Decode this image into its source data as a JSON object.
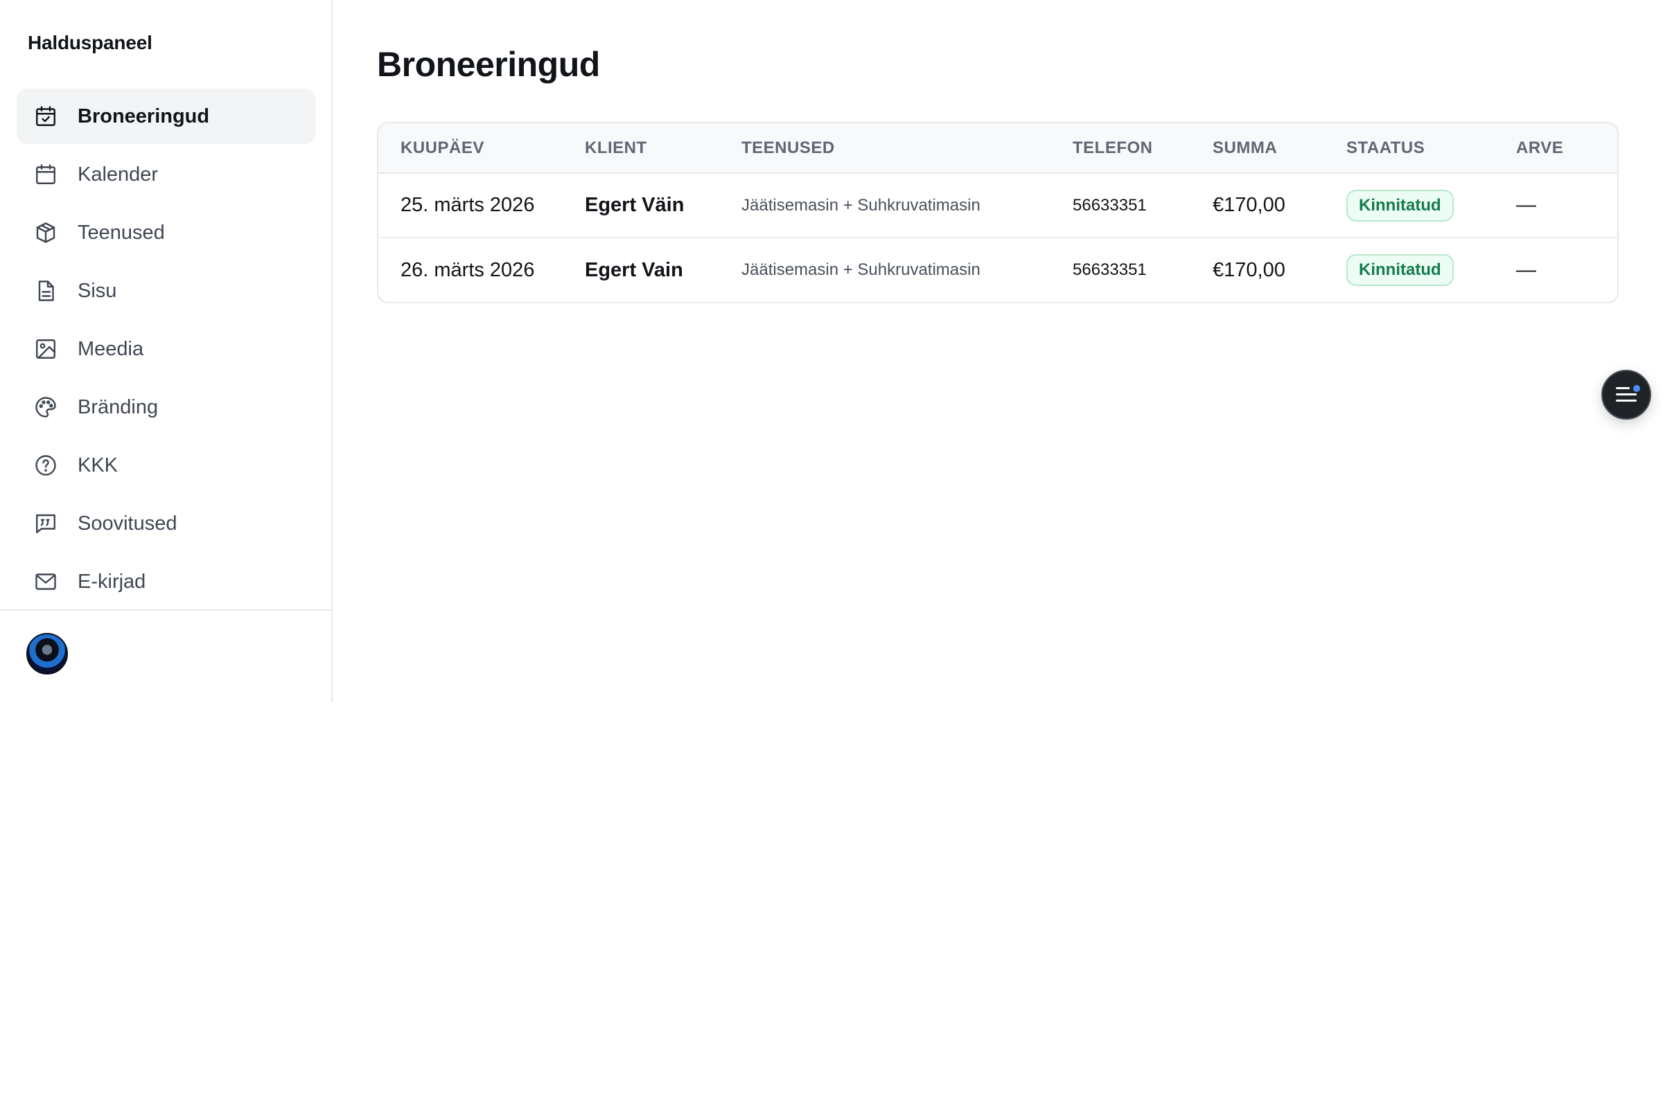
{
  "sidebar": {
    "brand": "Halduspaneel",
    "items": [
      {
        "label": "Broneeringud",
        "icon": "calendar-check-icon",
        "active": true
      },
      {
        "label": "Kalender",
        "icon": "calendar-icon",
        "active": false
      },
      {
        "label": "Teenused",
        "icon": "box-icon",
        "active": false
      },
      {
        "label": "Sisu",
        "icon": "document-icon",
        "active": false
      },
      {
        "label": "Meedia",
        "icon": "image-icon",
        "active": false
      },
      {
        "label": "Bränding",
        "icon": "palette-icon",
        "active": false
      },
      {
        "label": "KKK",
        "icon": "help-circle-icon",
        "active": false
      },
      {
        "label": "Soovitused",
        "icon": "quote-message-icon",
        "active": false
      },
      {
        "label": "E-kirjad",
        "icon": "mail-icon",
        "active": false
      }
    ],
    "avatar_icon": "user-avatar"
  },
  "main": {
    "title": "Broneeringud",
    "table": {
      "headers": [
        "KUUPÄEV",
        "KLIENT",
        "TEENUSED",
        "TELEFON",
        "SUMMA",
        "STAATUS",
        "ARVE"
      ],
      "rows": [
        {
          "date": "25. märts 2026",
          "client": "Egert Väin",
          "services": "Jäätisemasin + Suhkruvatimasin",
          "phone": "56633351",
          "sum": "€170,00",
          "status": "Kinnitatud",
          "invoice": "—"
        },
        {
          "date": "26. märts 2026",
          "client": "Egert Vain",
          "services": "Jäätisemasin + Suhkruvatimasin",
          "phone": "56633351",
          "sum": "€170,00",
          "status": "Kinnitatud",
          "invoice": "—"
        }
      ]
    }
  },
  "fab": {
    "icon": "menu-notification-icon"
  },
  "colors": {
    "accent_active_bg": "#f3f4f6",
    "status_green": "#157a4e",
    "status_bg": "#ecfdf3",
    "fab_bg": "#1f2227",
    "notification_dot": "#4c8ef7"
  }
}
